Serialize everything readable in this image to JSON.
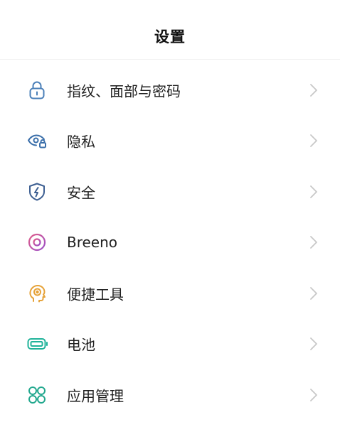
{
  "header": {
    "title": "设置"
  },
  "settings": {
    "items": [
      {
        "label": "指纹、面部与密码",
        "icon": "lock-icon",
        "icon_color": "#4a7fb8"
      },
      {
        "label": "隐私",
        "icon": "eye-lock-icon",
        "icon_color": "#3b6faa"
      },
      {
        "label": "安全",
        "icon": "shield-bolt-icon",
        "icon_color": "#3d5f92"
      },
      {
        "label": "Breeno",
        "icon": "breeno-ring-icon",
        "icon_color": "#c35bb3"
      },
      {
        "label": "便捷工具",
        "icon": "head-target-icon",
        "icon_color": "#e6a33a"
      },
      {
        "label": "电池",
        "icon": "battery-icon",
        "icon_color": "#20b39a"
      },
      {
        "label": "应用管理",
        "icon": "apps-grid-icon",
        "icon_color": "#22a88e"
      }
    ]
  },
  "chevron_color": "#c8c8c8"
}
